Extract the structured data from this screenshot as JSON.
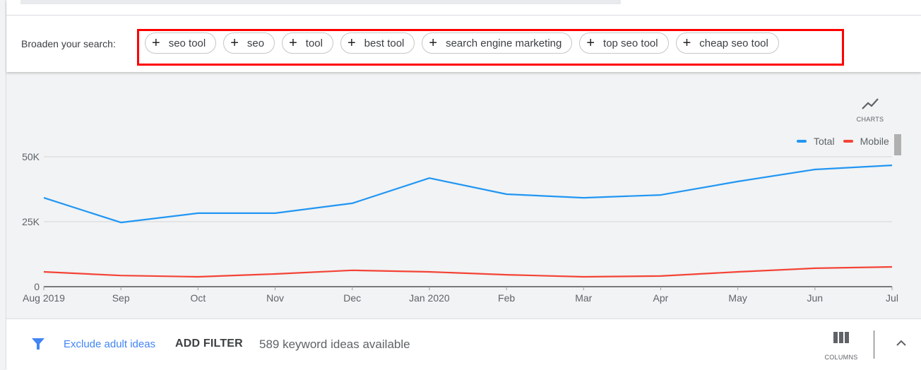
{
  "broaden": {
    "label": "Broaden your search:",
    "chips": [
      {
        "icon": "plus-icon",
        "label": "seo tool"
      },
      {
        "icon": "plus-icon",
        "label": "seo"
      },
      {
        "icon": "plus-icon",
        "label": "tool"
      },
      {
        "icon": "plus-icon",
        "label": "best tool"
      },
      {
        "icon": "plus-icon",
        "label": "search engine marketing"
      },
      {
        "icon": "plus-icon",
        "label": "top seo tool"
      },
      {
        "icon": "plus-icon",
        "label": "cheap seo tool"
      }
    ],
    "highlight_color": "#ff0000"
  },
  "chart_toolbar": {
    "icon": "line-chart-icon",
    "label": "CHARTS"
  },
  "chart_data": {
    "type": "line",
    "title": "",
    "xlabel": "",
    "ylabel": "",
    "categories": [
      "Aug 2019",
      "Sep",
      "Oct",
      "Nov",
      "Dec",
      "Jan 2020",
      "Feb",
      "Mar",
      "Apr",
      "May",
      "Jun",
      "Jul"
    ],
    "y_ticks": [
      {
        "value": 0,
        "label": "0"
      },
      {
        "value": 25000,
        "label": "25K"
      },
      {
        "value": 50000,
        "label": "50K"
      }
    ],
    "ylim": [
      0,
      50000
    ],
    "grid": true,
    "legend_position": "top-right",
    "series": [
      {
        "name": "Total",
        "color": "#2196f3",
        "values": [
          34200,
          24700,
          28300,
          28300,
          32100,
          41800,
          35600,
          34200,
          35300,
          40500,
          45100,
          46700
        ]
      },
      {
        "name": "Mobile",
        "color": "#f44336",
        "values": [
          5700,
          4300,
          3800,
          4900,
          6300,
          5700,
          4600,
          3800,
          4100,
          5700,
          7100,
          7600
        ]
      }
    ]
  },
  "bottom_bar": {
    "filter_icon": "filter-icon",
    "exclude_link": "Exclude adult ideas",
    "add_filter": "ADD FILTER",
    "ideas_count": "589 keyword ideas available",
    "columns_label": "COLUMNS",
    "columns_icon": "columns-icon",
    "collapse_icon": "chevron-up-icon",
    "accent_color": "#4285f4"
  }
}
